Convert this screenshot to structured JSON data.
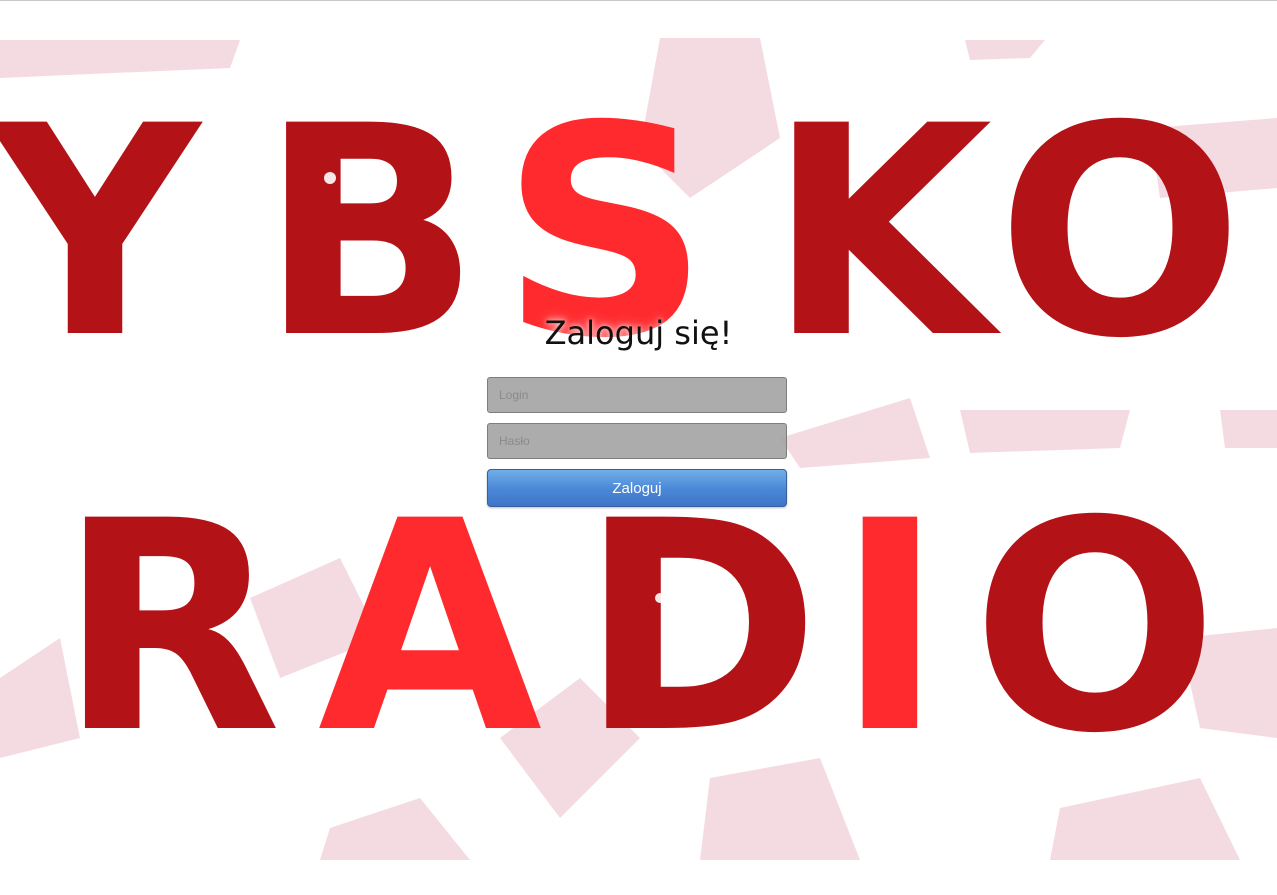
{
  "background": {
    "brand_text_line1": "YBSKO",
    "brand_text_line2": "RADIO",
    "colors": {
      "dark_red": "#b31217",
      "bright_red": "#ff2a2e",
      "faint_pink": "#f2d5dc"
    }
  },
  "login": {
    "title": "Zaloguj się!",
    "login_placeholder": "Login",
    "password_placeholder": "Hasło",
    "submit_label": "Zaloguj"
  }
}
